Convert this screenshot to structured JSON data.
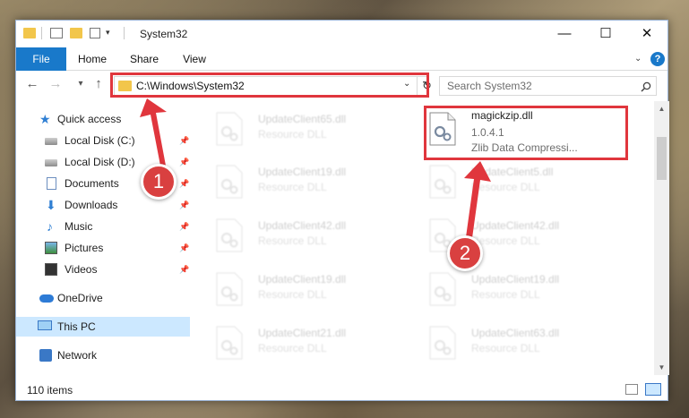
{
  "window": {
    "title": "System32",
    "controls": {
      "minimize": "—",
      "maximize": "☐",
      "close": "✕"
    },
    "quick_access_toolbar_arrow": "▾"
  },
  "ribbon": {
    "tabs": [
      "File",
      "Home",
      "Share",
      "View"
    ],
    "expand_chevron": "⌄",
    "help": "?"
  },
  "navigation": {
    "back": "←",
    "forward": "→",
    "recent": "▾",
    "up": "↑"
  },
  "address": {
    "path": "C:\\Windows\\System32",
    "dropdown": "⌄",
    "refresh": "↻"
  },
  "search": {
    "placeholder": "Search System32"
  },
  "sidebar": {
    "items": [
      {
        "label": "Quick access",
        "icon": "star-icon",
        "pinned": false
      },
      {
        "label": "Local Disk (C:)",
        "icon": "drive-icon",
        "pinned": true
      },
      {
        "label": "Local Disk (D:)",
        "icon": "drive-icon",
        "pinned": true
      },
      {
        "label": "Documents",
        "icon": "documents-icon",
        "pinned": true
      },
      {
        "label": "Downloads",
        "icon": "download-icon",
        "pinned": true
      },
      {
        "label": "Music",
        "icon": "music-icon",
        "pinned": true
      },
      {
        "label": "Pictures",
        "icon": "pictures-icon",
        "pinned": true
      },
      {
        "label": "Videos",
        "icon": "videos-icon",
        "pinned": true
      },
      {
        "label": "OneDrive",
        "icon": "cloud-icon",
        "pinned": false
      },
      {
        "label": "This PC",
        "icon": "computer-icon",
        "pinned": false,
        "selected": true
      },
      {
        "label": "Network",
        "icon": "network-icon",
        "pinned": false
      }
    ],
    "pin_glyph": "📌"
  },
  "files": {
    "left_column": [
      {
        "name": "UpdateClient65.dll",
        "type": "Resource DLL"
      },
      {
        "name": "UpdateClient19.dll",
        "type": "Resource DLL"
      },
      {
        "name": "UpdateClient42.dll",
        "type": "Resource DLL"
      },
      {
        "name": "UpdateClient19.dll",
        "type": "Resource DLL"
      },
      {
        "name": "UpdateClient21.dll",
        "type": "Resource DLL"
      }
    ],
    "right_column": [
      {
        "name": "magickzip.dll",
        "version": "1.0.4.1",
        "description": "Zlib Data Compressi...",
        "highlighted": true
      },
      {
        "name": "UpdateClient5.dll",
        "type": "Resource DLL"
      },
      {
        "name": "UpdateClient42.dll",
        "type": "Resource DLL"
      },
      {
        "name": "UpdateClient19.dll",
        "type": "Resource DLL"
      },
      {
        "name": "UpdateClient63.dll",
        "type": "Resource DLL"
      }
    ]
  },
  "status": {
    "item_count": "110 items"
  },
  "annotations": {
    "badges": [
      "1",
      "2"
    ],
    "color": "#e0363d"
  },
  "colors": {
    "accent": "#1979ca",
    "selection": "#cce8ff",
    "annotation_red": "#d94040"
  }
}
